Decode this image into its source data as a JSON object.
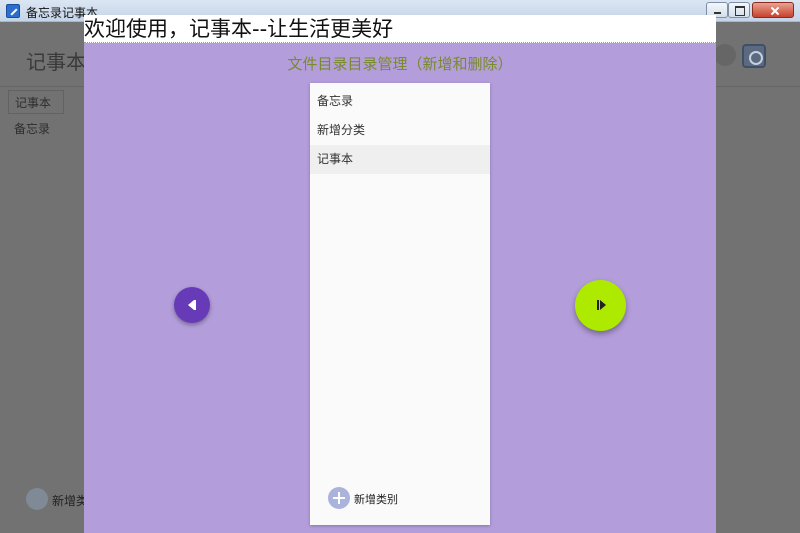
{
  "window": {
    "title": "备忘录记事本"
  },
  "background_app": {
    "header_title": "记事本",
    "tabs": [
      {
        "label": "记事本"
      }
    ],
    "list": [
      {
        "label": "备忘录"
      }
    ],
    "add_label": "新增类"
  },
  "dialog": {
    "banner": "欢迎使用，记事本--让生活更美好",
    "subtitle": "文件目录目录管理（新增和删除）",
    "items": [
      {
        "label": "备忘录",
        "selected": false
      },
      {
        "label": "新增分类",
        "selected": false
      },
      {
        "label": "记事本",
        "selected": true
      }
    ],
    "add_button_label": "新增类别"
  },
  "colors": {
    "dialog_bg": "#b39ddb",
    "subtitle": "#7a8a2e",
    "prev_button": "#673ab7",
    "next_button": "#aeea00"
  },
  "icons": {
    "prev": "skip-previous-icon",
    "next": "skip-next-icon",
    "add": "plus-icon",
    "settings": "gear-icon"
  }
}
